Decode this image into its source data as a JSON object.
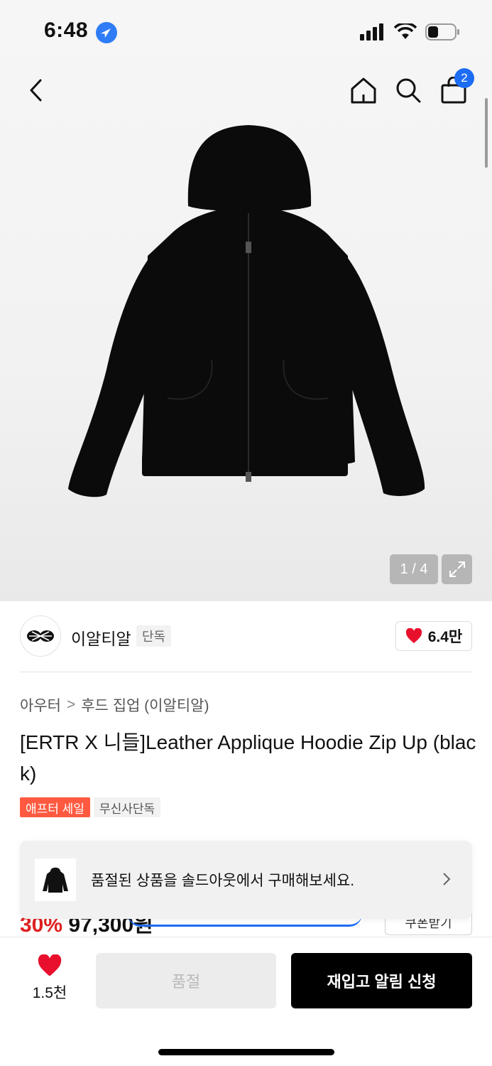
{
  "status": {
    "time": "6:48"
  },
  "nav": {
    "cart_count": "2"
  },
  "gallery": {
    "counter": "1 / 4"
  },
  "brand": {
    "name": "이알티알",
    "tag": "단독",
    "likes": "6.4만"
  },
  "breadcrumb": {
    "category": "아우터",
    "separator": ">",
    "subcategory": "후드 집업 (이알티알)"
  },
  "product": {
    "title": "[ERTR X 니들]Leather Applique Hoodie Zip Up (black)",
    "badges": [
      "애프터 세일",
      "무신사단독"
    ]
  },
  "price_peek": {
    "discount": "30%",
    "price": "97,300원"
  },
  "coupon_peek": {
    "label": "쿠폰받기"
  },
  "toast": {
    "message": "품절된 상품을 솔드아웃에서 구매해보세요."
  },
  "bottom": {
    "wish_count": "1.5천",
    "soldout_label": "품절",
    "restock_label": "재입고 알림 신청"
  },
  "colors": {
    "accent_blue": "#1c6cf4",
    "sale_orange": "#ff5a40",
    "heart_red": "#e8102c"
  }
}
